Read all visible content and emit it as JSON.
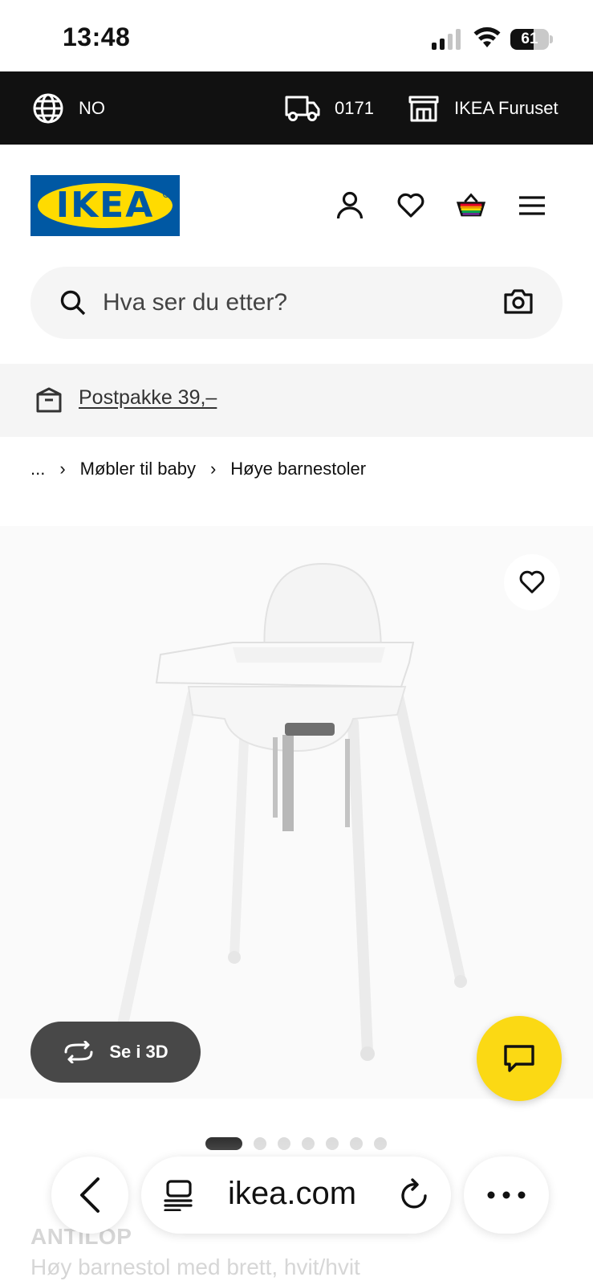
{
  "status_bar": {
    "time": "13:48",
    "battery_percent": "61",
    "battery_level": 0.61
  },
  "top_bar": {
    "language": "NO",
    "postal_code": "0171",
    "store": "IKEA Furuset"
  },
  "header": {
    "logo_text": "IKEA"
  },
  "search": {
    "placeholder": "Hva ser du etter?"
  },
  "promo": {
    "text": "Postpakke 39,–"
  },
  "breadcrumb": {
    "items": [
      "...",
      "Møbler til baby",
      "Høye barnestoler"
    ]
  },
  "gallery": {
    "see_3d_label": "Se i 3D",
    "image_count": 7,
    "active_index": 0
  },
  "product": {
    "name": "ANTILOP",
    "description": "Høy barnestol med brett, hvit/hvit"
  },
  "browser": {
    "domain": "ikea.com"
  },
  "colors": {
    "top_bar_bg": "#111111",
    "ikea_blue": "#0058a3",
    "ikea_yellow": "#ffdb00",
    "chat_yellow": "#fbd914",
    "button_dark": "#484848"
  }
}
